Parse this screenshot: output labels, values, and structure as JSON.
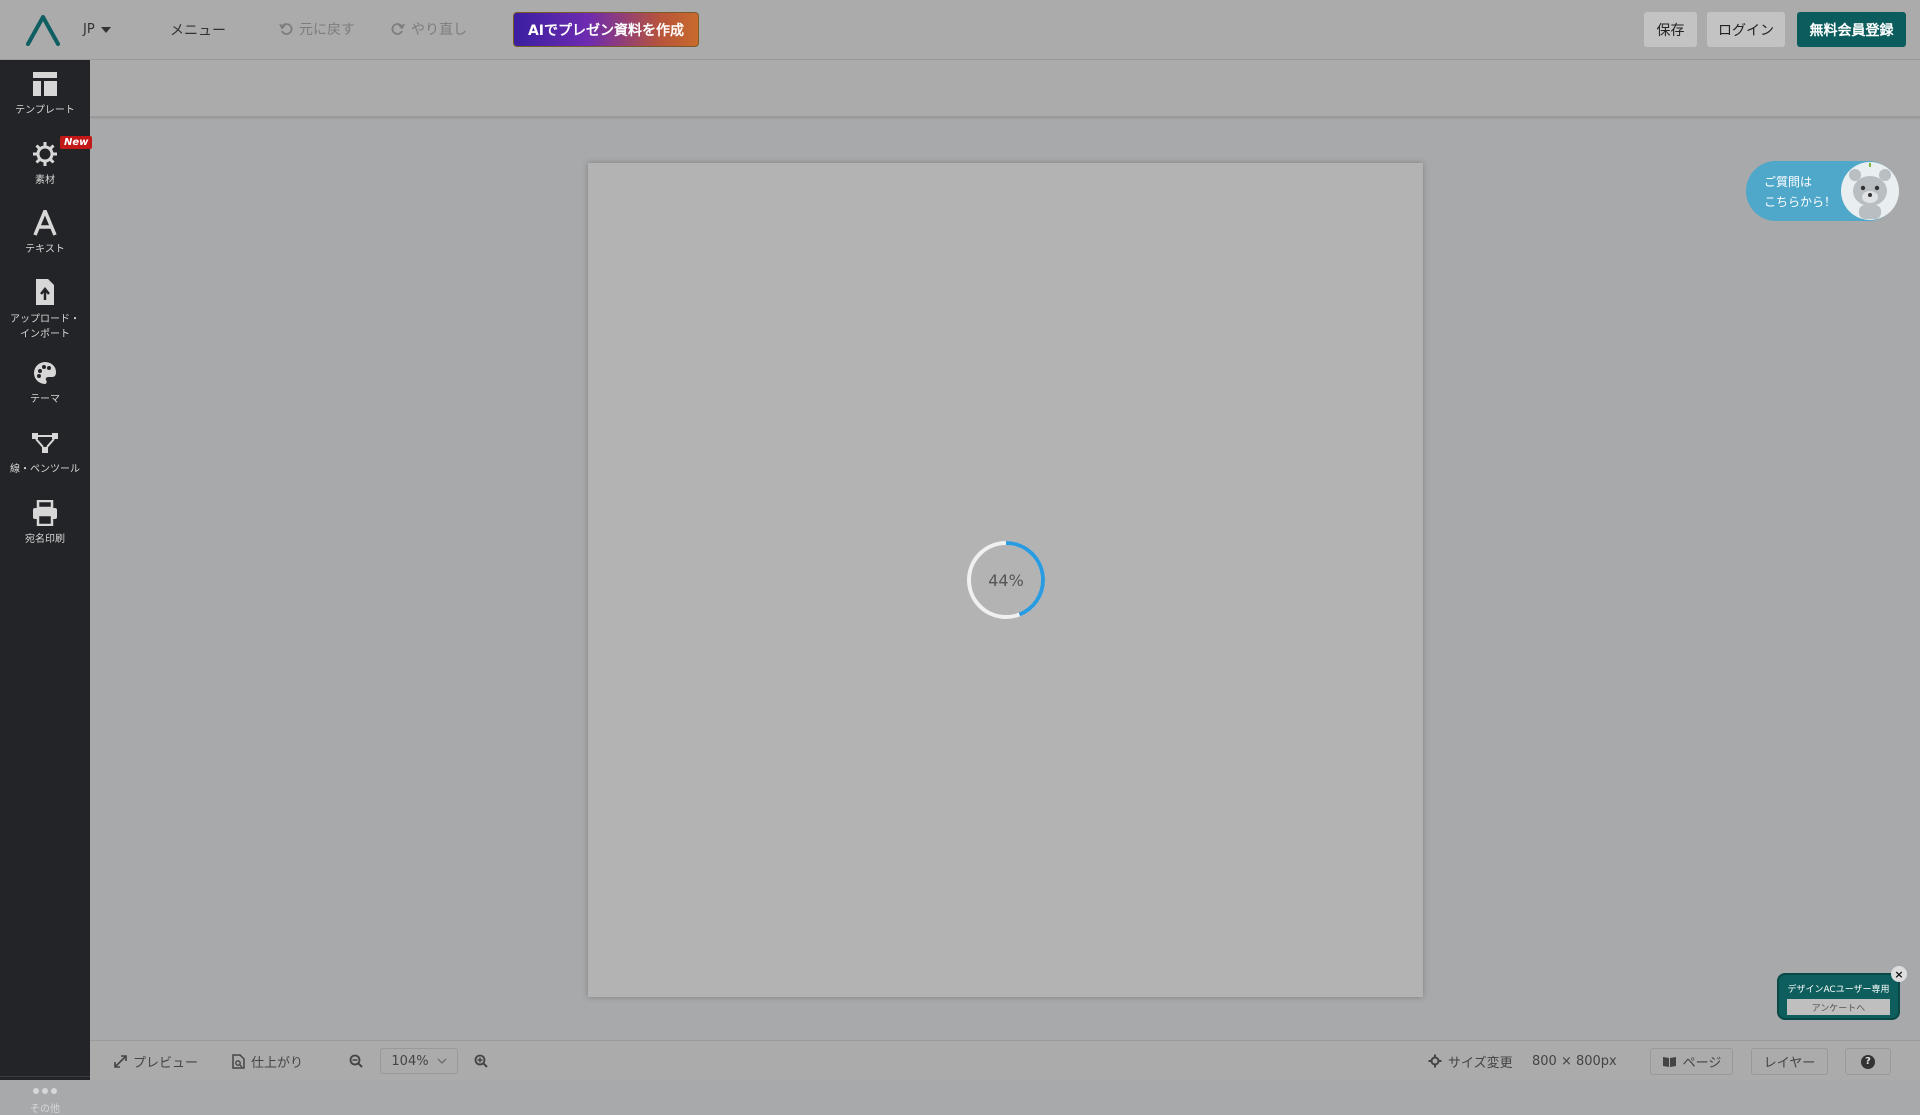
{
  "topbar": {
    "language": "JP",
    "menu_label": "メニュー",
    "undo_label": "元に戻す",
    "redo_label": "やり直し",
    "ai_button_label": "AIでプレゼン資料を作成",
    "save_label": "保存",
    "login_label": "ログイン",
    "signup_label": "無料会員登録"
  },
  "sidebar": {
    "items": [
      {
        "label": "テンプレート",
        "icon": "template-icon"
      },
      {
        "label": "素材",
        "icon": "gear-icon",
        "badge": "New"
      },
      {
        "label": "テキスト",
        "icon": "text-icon"
      },
      {
        "label_line1": "アップロード・",
        "label_line2": "インポート",
        "icon": "upload-icon"
      },
      {
        "label": "テーマ",
        "icon": "palette-icon"
      },
      {
        "label": "線・ペンツール",
        "icon": "pen-tool-icon"
      },
      {
        "label": "宛名印刷",
        "icon": "printer-icon"
      }
    ],
    "more_label": "その他"
  },
  "canvas": {
    "loading_text": "44%",
    "progress": 0.44
  },
  "help_bubble": {
    "line1": "ご質問は",
    "line2": "こちらから！"
  },
  "survey": {
    "title": "デザインACユーザー専用",
    "button_label": "アンケートへ",
    "close_label": "×"
  },
  "bottombar": {
    "preview_label": "プレビュー",
    "finish_label": "仕上がり",
    "zoom_value": "104%",
    "resize_label": "サイズ変更",
    "size_text": "800 × 800px",
    "page_label": "ページ",
    "layer_label": "レイヤー",
    "help_label": "?"
  },
  "colors": {
    "sidebar_bg": "#232427",
    "signup_bg": "#0b5c5c",
    "spinner_accent": "#2b9be0",
    "help_bubble_bg": "#4fa7c9"
  }
}
